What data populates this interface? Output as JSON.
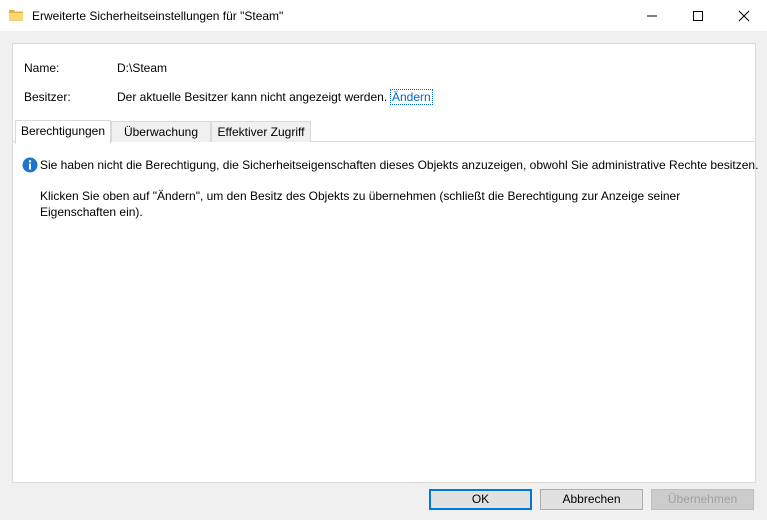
{
  "window": {
    "title": "Erweiterte Sicherheitseinstellungen für \"Steam\"",
    "icon": "folder-icon"
  },
  "fields": {
    "name_label": "Name:",
    "name_value": "D:\\Steam",
    "owner_label": "Besitzer:",
    "owner_value": "Der aktuelle Besitzer kann nicht angezeigt werden.",
    "change_link": "Ändern"
  },
  "tabs": [
    {
      "label": "Berechtigungen",
      "active": true
    },
    {
      "label": "Überwachung",
      "active": false
    },
    {
      "label": "Effektiver Zugriff",
      "active": false
    }
  ],
  "message": {
    "icon": "info-icon",
    "line1": "Sie haben nicht die Berechtigung, die Sicherheitseigenschaften dieses Objekts anzuzeigen, obwohl Sie administrative Rechte besitzen.",
    "line2": "Klicken Sie oben auf \"Ändern\", um den Besitz des Objekts zu übernehmen (schließt die Berechtigung zur Anzeige seiner",
    "line3": "Eigenschaften ein)."
  },
  "buttons": {
    "ok": "OK",
    "cancel": "Abbrechen",
    "apply": "Übernehmen"
  },
  "colors": {
    "accent": "#0078d7",
    "link": "#0066cc",
    "info": "#1e74c8"
  }
}
